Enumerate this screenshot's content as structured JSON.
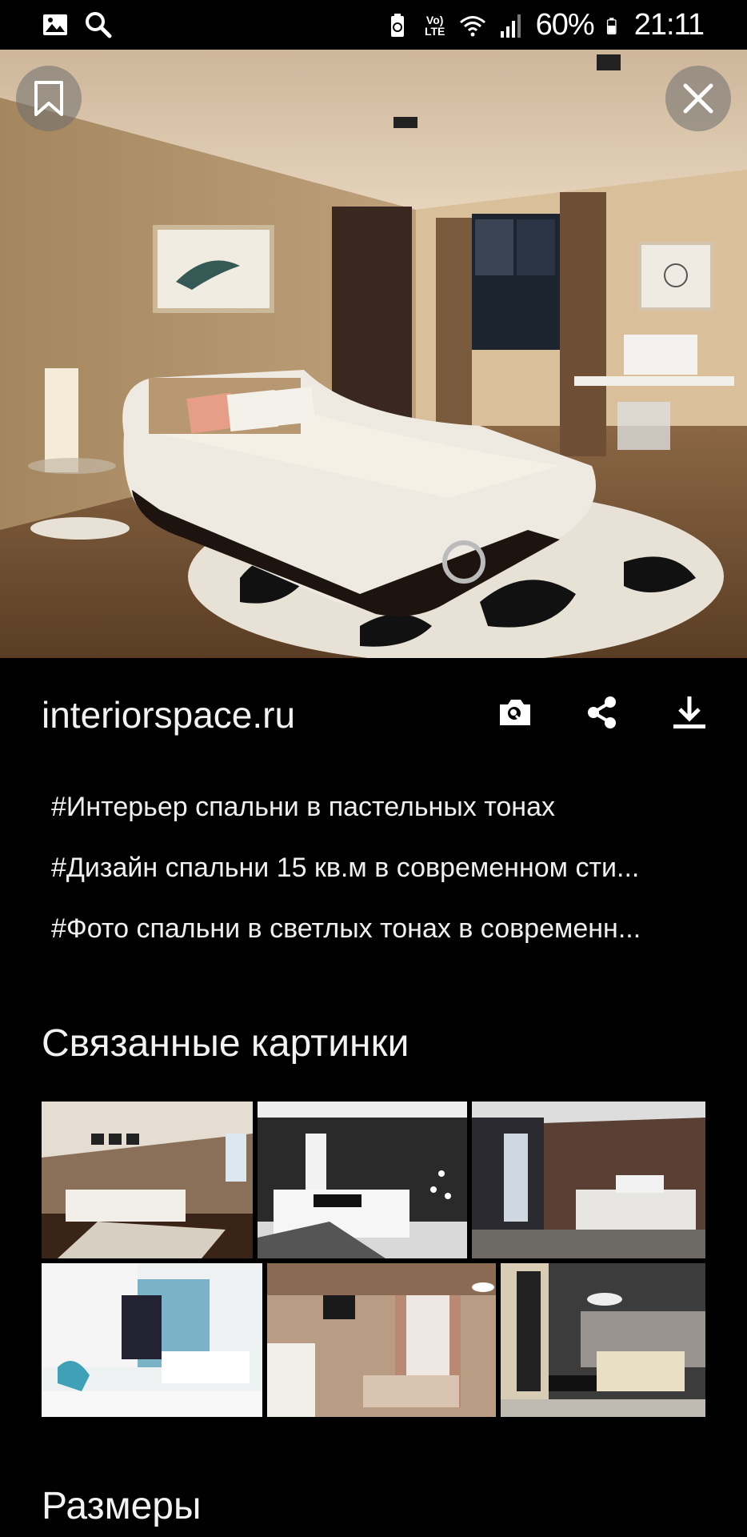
{
  "status_bar": {
    "left_icons": [
      "gallery-icon",
      "search-icon"
    ],
    "right_icons": [
      "battery-saver-icon",
      "volte-icon",
      "wifi-icon",
      "signal-icon",
      "battery-icon"
    ],
    "volte_label": "Vo) LTE",
    "battery_percent": "60%",
    "time": "21:11"
  },
  "viewer": {
    "bookmark_icon": "bookmark-icon",
    "close_icon": "close-icon",
    "source": "interiorspace.ru",
    "actions": [
      "lens-search-icon",
      "share-icon",
      "download-icon"
    ]
  },
  "tags": [
    "#Интерьер спальни в пастельных тонах",
    "#Дизайн спальни 15 кв.м в современном сти...",
    "#Фото спальни в светлых тонах в современн..."
  ],
  "related": {
    "title": "Связанные картинки"
  },
  "sizes": {
    "title": "Размеры"
  },
  "colors": {
    "background": "#000000",
    "text": "#f2f2f2",
    "overlay_button": "#6e6e6e"
  }
}
